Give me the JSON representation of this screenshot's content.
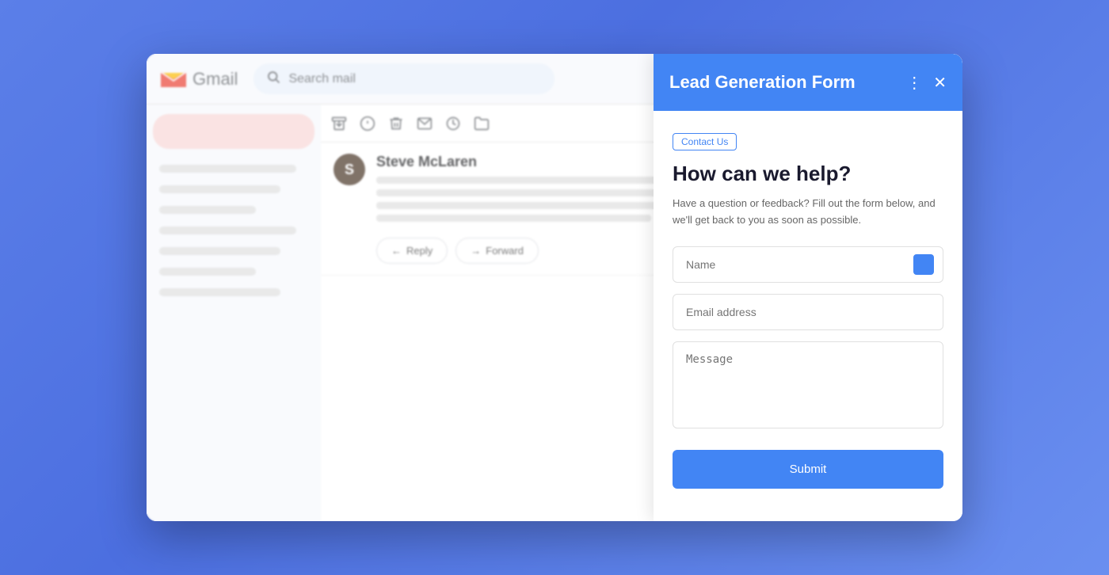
{
  "app": {
    "name": "Gmail",
    "search_placeholder": "Search mail"
  },
  "sidebar": {
    "compose_label": ""
  },
  "email": {
    "sender_avatar_letter": "S",
    "sender_name": "Steve McLaren",
    "reply_label": "Reply",
    "forward_label": "Forward"
  },
  "panel": {
    "title": "Lead Generation Form",
    "contact_us_badge": "Contact Us",
    "heading": "How can we help?",
    "description": "Have a question or feedback? Fill out the form below, and we'll get back to you as soon as possible.",
    "name_placeholder": "Name",
    "email_placeholder": "Email address",
    "message_placeholder": "Message",
    "submit_label": "Submit"
  },
  "icons": {
    "more_vert": "⋮",
    "close": "✕",
    "search": "🔍",
    "archive": "⊡",
    "info": "ℹ",
    "delete": "🗑",
    "mail": "✉",
    "clock": "🕐",
    "folder": "📁",
    "reply_arrow": "←",
    "forward_arrow": "→",
    "plus": "+"
  }
}
